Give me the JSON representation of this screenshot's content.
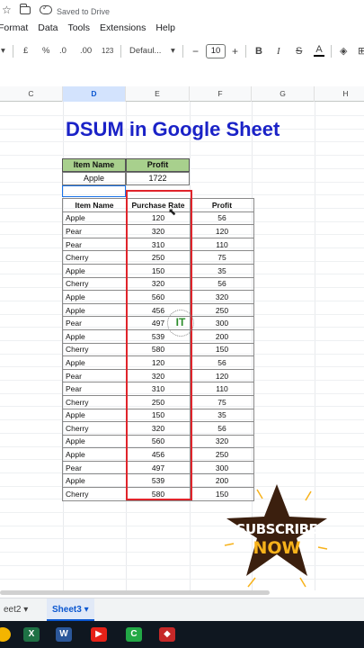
{
  "header": {
    "save_status": "Saved to Drive"
  },
  "menu": [
    "Format",
    "Data",
    "Tools",
    "Extensions",
    "Help"
  ],
  "toolbar": {
    "currency": "£",
    "percent": "%",
    "dec_less": ".0",
    "dec_more": ".00",
    "number_format": "123",
    "font_name": "Defaul...",
    "font_size": "10",
    "minus": "−",
    "plus": "+",
    "bold": "B",
    "italic": "I",
    "strike": "S",
    "text_color": "A"
  },
  "columns": [
    "C",
    "D",
    "E",
    "F",
    "G",
    "H"
  ],
  "sheet_title": "DSUM in Google Sheet",
  "criteria": {
    "headers": [
      "Item Name",
      "Profit"
    ],
    "values": [
      "Apple",
      "1722"
    ]
  },
  "table": {
    "headers": [
      "Item Name",
      "Purchase Rate",
      "Profit"
    ],
    "rows": [
      [
        "Apple",
        "120",
        "56"
      ],
      [
        "Pear",
        "320",
        "120"
      ],
      [
        "Pear",
        "310",
        "110"
      ],
      [
        "Cherry",
        "250",
        "75"
      ],
      [
        "Apple",
        "150",
        "35"
      ],
      [
        "Cherry",
        "320",
        "56"
      ],
      [
        "Apple",
        "560",
        "320"
      ],
      [
        "Apple",
        "456",
        "250"
      ],
      [
        "Pear",
        "497",
        "300"
      ],
      [
        "Apple",
        "539",
        "200"
      ],
      [
        "Cherry",
        "580",
        "150"
      ],
      [
        "Apple",
        "120",
        "56"
      ],
      [
        "Pear",
        "320",
        "120"
      ],
      [
        "Pear",
        "310",
        "110"
      ],
      [
        "Cherry",
        "250",
        "75"
      ],
      [
        "Apple",
        "150",
        "35"
      ],
      [
        "Cherry",
        "320",
        "56"
      ],
      [
        "Apple",
        "560",
        "320"
      ],
      [
        "Apple",
        "456",
        "250"
      ],
      [
        "Pear",
        "497",
        "300"
      ],
      [
        "Apple",
        "539",
        "200"
      ],
      [
        "Cherry",
        "580",
        "150"
      ]
    ]
  },
  "watermark": "IT",
  "subscribe": {
    "line1": "SUBSCRIBE",
    "line2": "NOW"
  },
  "sheet_tabs": [
    "eet2",
    "Sheet3"
  ],
  "colors": {
    "title": "#1a22c7",
    "criteria_header": "#a8d08d",
    "highlight": "#e0242b",
    "subscribe_star": "#3b1f0e",
    "subscribe_now": "#f7b21b"
  }
}
